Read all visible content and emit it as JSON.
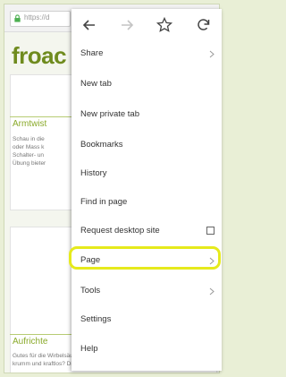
{
  "browser": {
    "url_display": "https://d"
  },
  "page": {
    "logo_text": "froac",
    "cards": [
      {
        "title": "Armtwist",
        "lines": [
          "Schau in die",
          "oder Mass k",
          "Schalter- un",
          "Übung bieter"
        ]
      },
      {
        "title": "Aufrichte",
        "lines": [
          "Gutes für die Wirbelsäule – Fühlst du dich manchmal",
          "krumm und kraftlos? Diese Übung aktiviert die"
        ]
      }
    ]
  },
  "menu": {
    "toolbar": [
      "back-icon",
      "forward-icon",
      "bookmark-star-icon",
      "refresh-icon"
    ],
    "items": [
      {
        "label": "Share",
        "submenu": true
      },
      {
        "label": "New tab"
      },
      {
        "label": "New private tab"
      },
      {
        "label": "Bookmarks"
      },
      {
        "label": "History"
      },
      {
        "label": "Find in page"
      },
      {
        "label": "Request desktop site",
        "checkbox": false
      },
      {
        "label": "Page",
        "submenu": true,
        "highlighted": true
      },
      {
        "label": "Tools",
        "submenu": true
      },
      {
        "label": "Settings"
      },
      {
        "label": "Help"
      }
    ]
  },
  "colors": {
    "brand_green": "#6f8b1e",
    "highlight_yellow": "#e6ea1c",
    "background": "#e9efd6"
  }
}
